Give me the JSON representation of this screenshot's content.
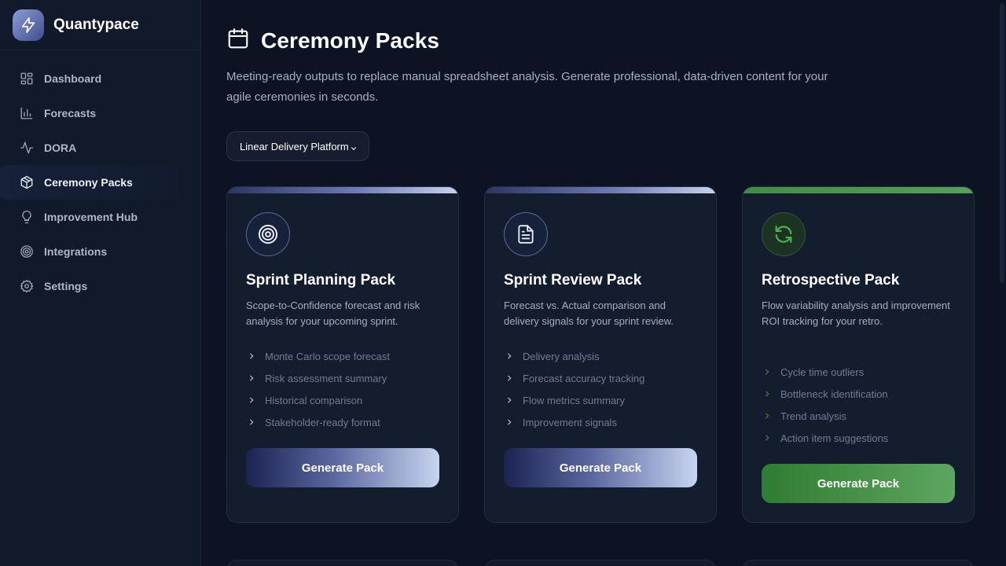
{
  "app": {
    "name": "Quantypace"
  },
  "sidebar": {
    "items": [
      {
        "label": "Dashboard",
        "icon": "dashboard-grid-icon",
        "active": false
      },
      {
        "label": "Forecasts",
        "icon": "bar-chart-icon",
        "active": false
      },
      {
        "label": "DORA",
        "icon": "activity-pulse-icon",
        "active": false
      },
      {
        "label": "Ceremony Packs",
        "icon": "package-box-icon",
        "active": true
      },
      {
        "label": "Improvement Hub",
        "icon": "lightbulb-icon",
        "active": false
      },
      {
        "label": "Integrations",
        "icon": "target-icon",
        "active": false
      },
      {
        "label": "Settings",
        "icon": "gear-icon",
        "active": false
      }
    ]
  },
  "page": {
    "title": "Ceremony Packs",
    "title_icon": "calendar-icon",
    "description": "Meeting-ready outputs to replace manual spreadsheet analysis. Generate professional, data-driven content for your agile ceremonies in seconds."
  },
  "platform_select": {
    "value": "Linear Delivery Platform"
  },
  "cards": [
    {
      "title": "Sprint Planning Pack",
      "icon": "target-icon",
      "description": "Scope-to-Confidence forecast and risk analysis for your upcoming sprint.",
      "features": [
        "Monte Carlo scope forecast",
        "Risk assessment summary",
        "Historical comparison",
        "Stakeholder-ready format"
      ],
      "button": "Generate Pack",
      "accent": "#8e9ad0"
    },
    {
      "title": "Sprint Review Pack",
      "icon": "document-icon",
      "description": "Forecast vs. Actual comparison and delivery signals for your sprint review.",
      "features": [
        "Delivery analysis",
        "Forecast accuracy tracking",
        "Flow metrics summary",
        "Improvement signals"
      ],
      "button": "Generate Pack",
      "accent": "#8e9ad0"
    },
    {
      "title": "Retrospective Pack",
      "icon": "refresh-icon",
      "description": "Flow variability analysis and improvement ROI tracking for your retro.",
      "features": [
        "Cycle time outliers",
        "Bottleneck identification",
        "Trend analysis",
        "Action item suggestions"
      ],
      "button": "Generate Pack",
      "accent": "#4a9a4d"
    }
  ]
}
